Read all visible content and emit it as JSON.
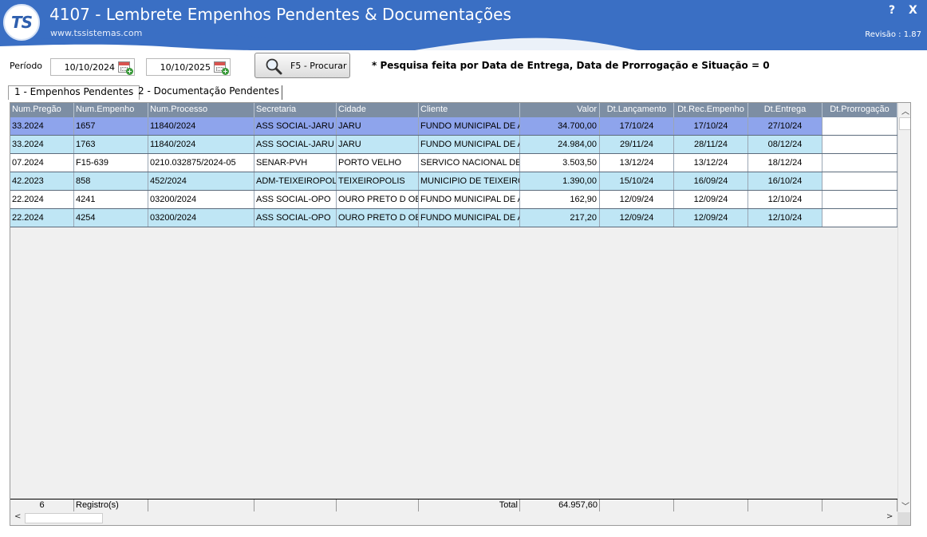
{
  "app": {
    "logo_text": "TS",
    "title": "4107 - Lembrete Empenhos Pendentes & Documentações",
    "website": "www.tssistemas.com",
    "help": "?",
    "close": "X",
    "revision": "Revisão : 1.87"
  },
  "filters": {
    "period_label": "Período",
    "date_from": "10/10/2024",
    "date_to": "10/10/2025",
    "search_button": "F5 - Procurar",
    "note": "* Pesquisa feita por Data de Entrega, Data de Prorrogação e Situação = 0"
  },
  "tabs": [
    {
      "label": "1 - Empenhos Pendentes"
    },
    {
      "label": "2 - Documentação Pendentes"
    }
  ],
  "table": {
    "columns": [
      "Num.Pregão",
      "Num.Empenho",
      "Num.Processo",
      "Secretaria",
      "Cidade",
      "Cliente",
      "Valor",
      "Dt.Lançamento",
      "Dt.Rec.Empenho",
      "Dt.Entrega",
      "Dt.Prorrogação"
    ],
    "rows": [
      [
        "33.2024",
        "1657",
        "11840/2024",
        "ASS SOCIAL-JARU",
        "JARU",
        "FUNDO MUNICIPAL DE AS",
        "34.700,00",
        "17/10/24",
        "17/10/24",
        "27/10/24",
        ""
      ],
      [
        "33.2024",
        "1763",
        "11840/2024",
        "ASS SOCIAL-JARU",
        "JARU",
        "FUNDO MUNICIPAL DE AS",
        "24.984,00",
        "29/11/24",
        "28/11/24",
        "08/12/24",
        ""
      ],
      [
        "07.2024",
        "F15-639",
        "0210.032875/2024-05",
        "SENAR-PVH",
        "PORTO VELHO",
        "SERVICO NACIONAL DE A",
        "3.503,50",
        "13/12/24",
        "13/12/24",
        "18/12/24",
        ""
      ],
      [
        "42.2023",
        "858",
        "452/2024",
        "ADM-TEIXEIROPOLIS",
        "TEIXEIROPOLIS",
        "MUNICIPIO DE TEIXEIROI",
        "1.390,00",
        "15/10/24",
        "16/09/24",
        "16/10/24",
        ""
      ],
      [
        "22.2024",
        "4241",
        "03200/2024",
        "ASS SOCIAL-OPO",
        "OURO PRETO D OES",
        "FUNDO MUNICIPAL DE AS",
        "162,90",
        "12/09/24",
        "12/09/24",
        "12/10/24",
        ""
      ],
      [
        "22.2024",
        "4254",
        "03200/2024",
        "ASS SOCIAL-OPO",
        "OURO PRETO D OES",
        "FUNDO MUNICIPAL DE AS",
        "217,20",
        "12/09/24",
        "12/09/24",
        "12/10/24",
        ""
      ]
    ],
    "row_colors": [
      "#8ea4ec",
      "#bfe6f5",
      "#ffffff",
      "#bfe6f5",
      "#ffffff",
      "#bfe6f5"
    ],
    "footer": {
      "count": "6",
      "count_label": "Registro(s)",
      "total_label": "Total",
      "total_value": "64.957,60"
    }
  },
  "colors": {
    "header_bg": "#3a6fc4",
    "grid_header_bg": "#7d8ea3",
    "selected_row": "#8ea4ec",
    "alt_row": "#bfe6f5"
  }
}
